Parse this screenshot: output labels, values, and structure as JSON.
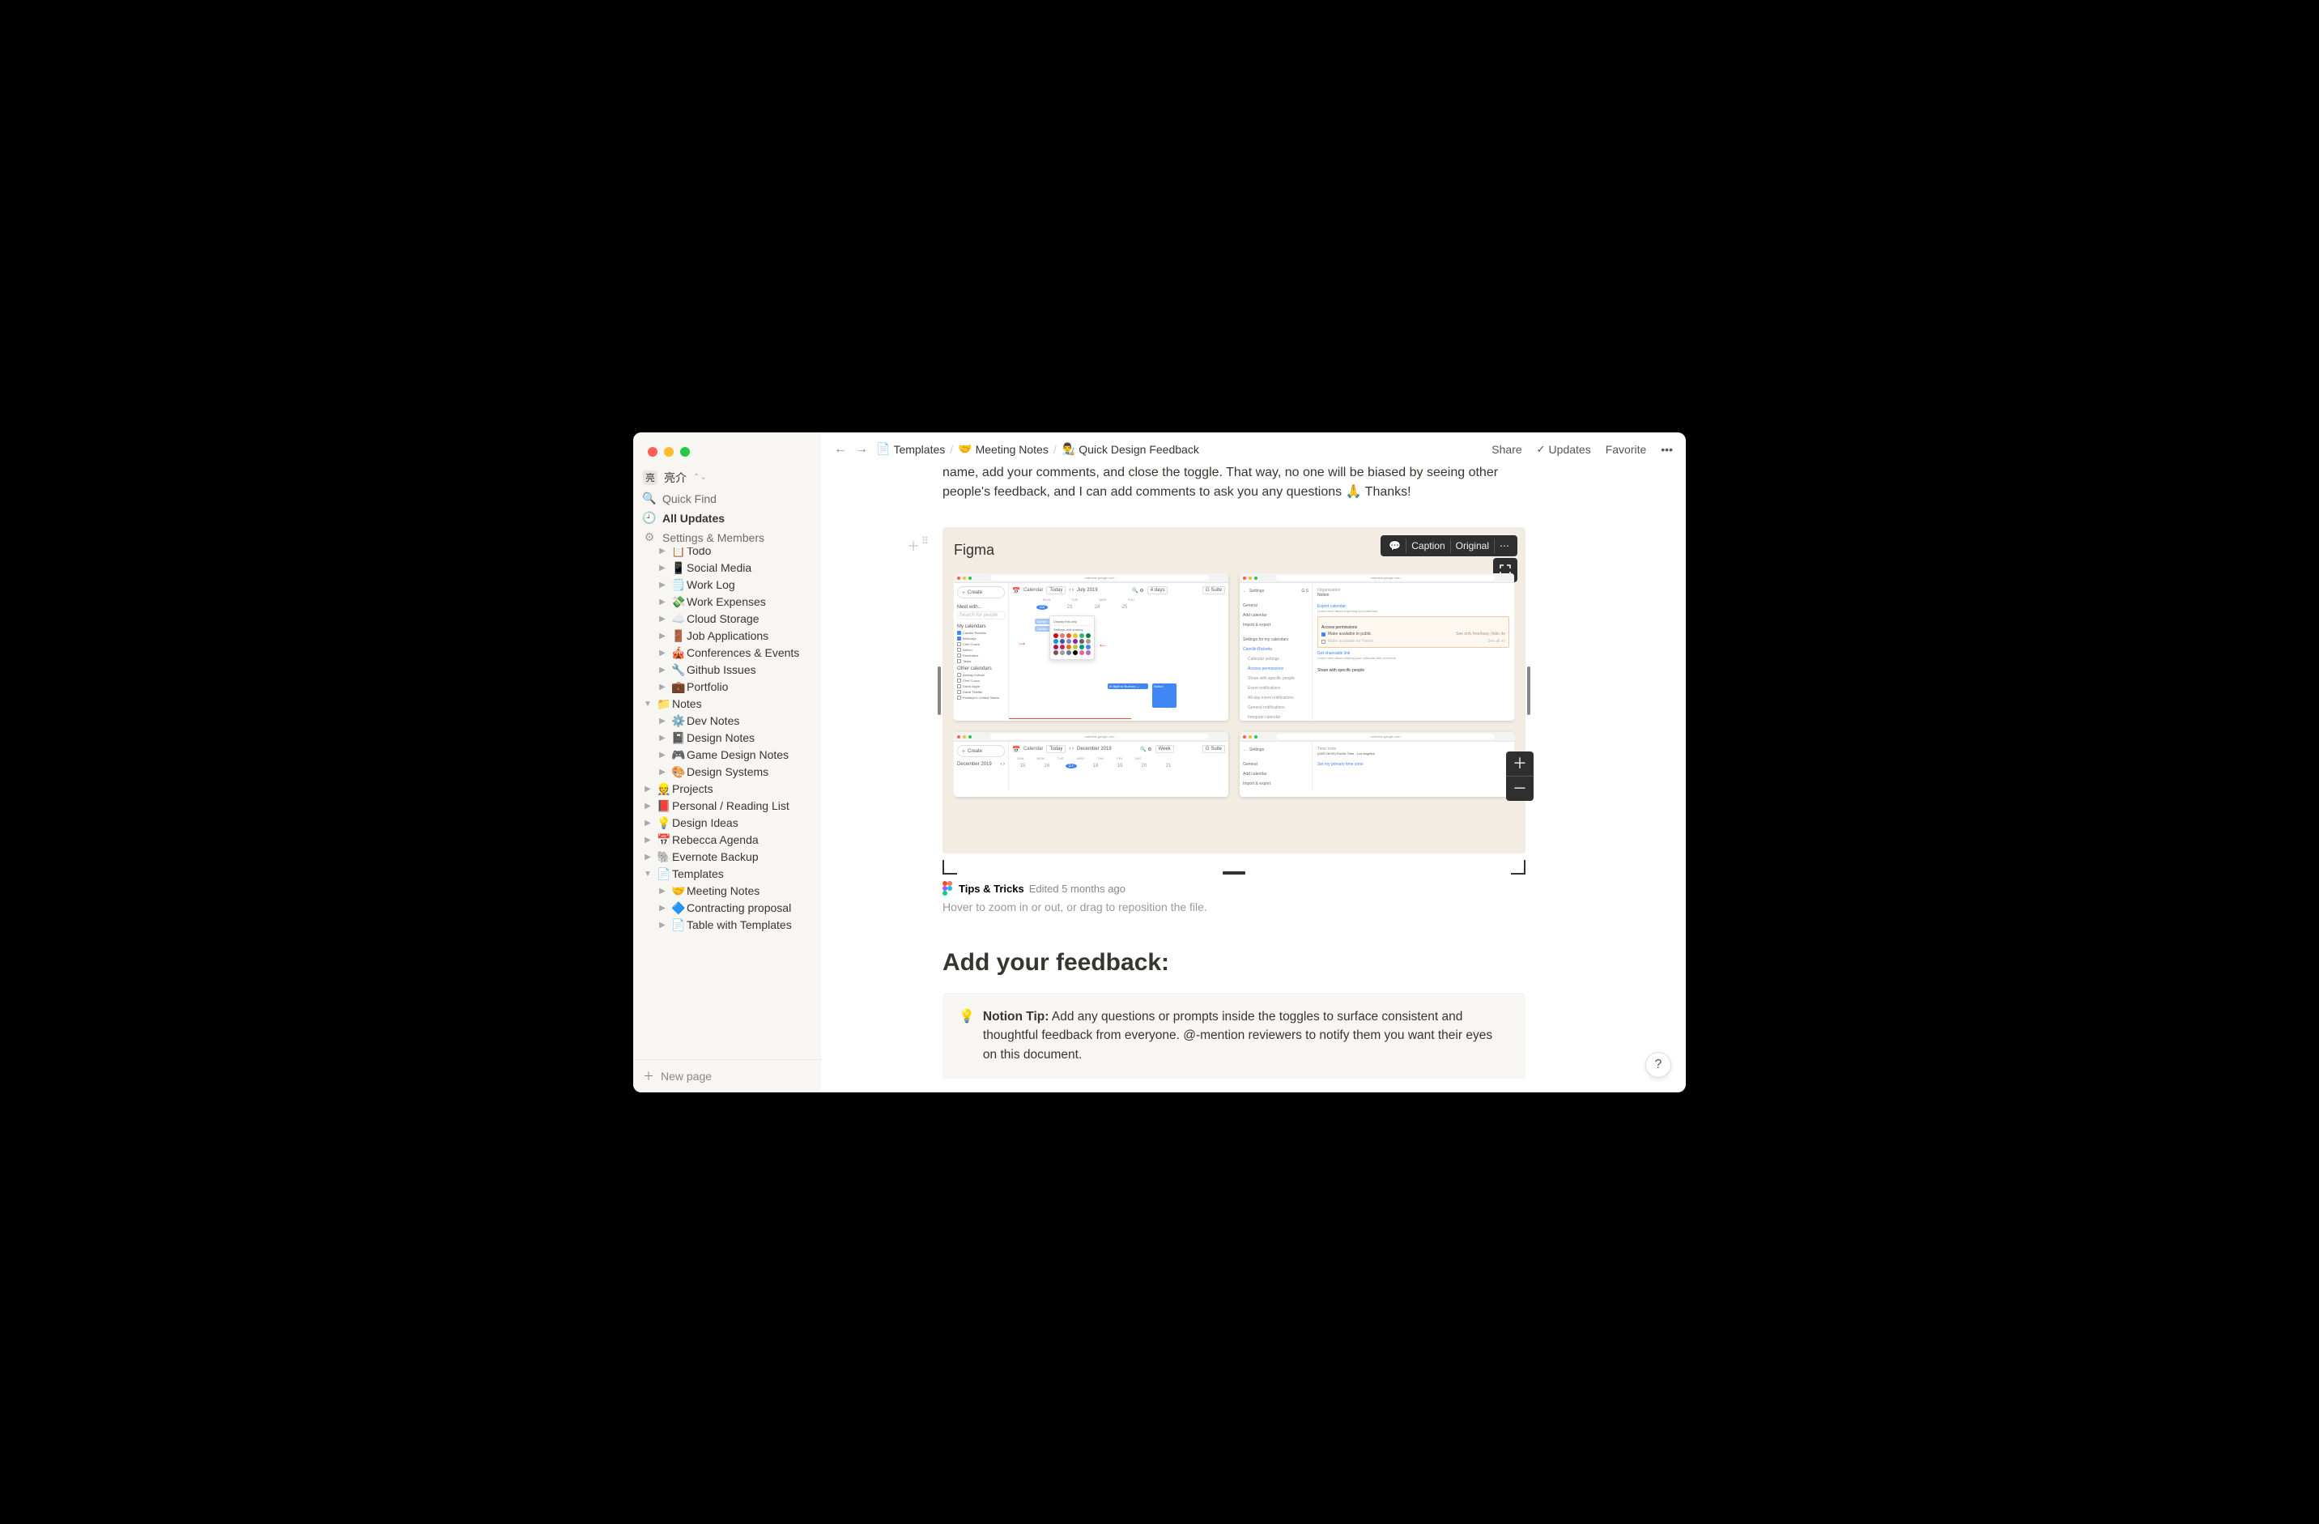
{
  "user": {
    "name": "亮介"
  },
  "quick_items": [
    {
      "icon": "search-icon",
      "label": "Quick Find"
    },
    {
      "icon": "clock-icon",
      "label": "All Updates",
      "active": true
    },
    {
      "icon": "gear-icon",
      "label": "Settings & Members"
    }
  ],
  "tree": [
    {
      "depth": 1,
      "arrow": "▶",
      "emoji": "📋",
      "label": "Todo",
      "cut": true
    },
    {
      "depth": 1,
      "arrow": "▶",
      "emoji": "📱",
      "label": "Social Media"
    },
    {
      "depth": 1,
      "arrow": "▶",
      "emoji": "🗒️",
      "label": "Work Log"
    },
    {
      "depth": 1,
      "arrow": "▶",
      "emoji": "💸",
      "label": "Work Expenses"
    },
    {
      "depth": 1,
      "arrow": "▶",
      "emoji": "☁️",
      "label": "Cloud Storage"
    },
    {
      "depth": 1,
      "arrow": "▶",
      "emoji": "🚪",
      "label": "Job Applications"
    },
    {
      "depth": 1,
      "arrow": "▶",
      "emoji": "🎪",
      "label": "Conferences & Events"
    },
    {
      "depth": 1,
      "arrow": "▶",
      "emoji": "🔧",
      "label": "Github Issues"
    },
    {
      "depth": 1,
      "arrow": "▶",
      "emoji": "💼",
      "label": "Portfolio"
    },
    {
      "depth": 0,
      "arrow": "▼",
      "emoji": "📁",
      "label": "Notes"
    },
    {
      "depth": 1,
      "arrow": "▶",
      "emoji": "⚙️",
      "label": "Dev Notes"
    },
    {
      "depth": 1,
      "arrow": "▶",
      "emoji": "📓",
      "label": "Design Notes"
    },
    {
      "depth": 1,
      "arrow": "▶",
      "emoji": "🎮",
      "label": "Game Design Notes"
    },
    {
      "depth": 1,
      "arrow": "▶",
      "emoji": "🎨",
      "label": "Design Systems"
    },
    {
      "depth": 0,
      "arrow": "▶",
      "emoji": "👷",
      "label": "Projects"
    },
    {
      "depth": 0,
      "arrow": "▶",
      "emoji": "📕",
      "label": "Personal / Reading List"
    },
    {
      "depth": 0,
      "arrow": "▶",
      "emoji": "💡",
      "label": "Design Ideas"
    },
    {
      "depth": 0,
      "arrow": "▶",
      "emoji": "📅",
      "label": "Rebecca Agenda"
    },
    {
      "depth": 0,
      "arrow": "▶",
      "emoji": "🐘",
      "label": "Evernote Backup"
    },
    {
      "depth": 0,
      "arrow": "▼",
      "emoji": "📄",
      "label": "Templates"
    },
    {
      "depth": 1,
      "arrow": "▶",
      "emoji": "🤝",
      "label": "Meeting Notes"
    },
    {
      "depth": 1,
      "arrow": "▶",
      "emoji": "🔷",
      "label": "Contracting proposal"
    },
    {
      "depth": 1,
      "arrow": "▶",
      "emoji": "📄",
      "label": "Table with Templates"
    }
  ],
  "new_page_label": "New page",
  "breadcrumb": [
    {
      "emoji": "📄",
      "label": "Templates"
    },
    {
      "emoji": "🤝",
      "label": "Meeting Notes"
    },
    {
      "emoji": "👨‍🎨",
      "label": "Quick Design Feedback"
    }
  ],
  "top_actions": {
    "share": "Share",
    "updates": "Updates",
    "favorite": "Favorite"
  },
  "intro_text": "name, add your comments, and close the toggle. That way, no one will be biased by seeing other people's feedback, and I can add comments to ask you any questions 🙏  Thanks!",
  "figma": {
    "title": "Figma",
    "toolbar": {
      "comment": "💬",
      "caption": "Caption",
      "original": "Original",
      "more": "⋯"
    },
    "caption": {
      "title": "Tips & Tricks",
      "edited": "Edited 5 months ago"
    },
    "hint": "Hover to zoom in or out, or drag to reposition the file.",
    "shot_url": "calendar.google.com",
    "shot1": {
      "app": "Calendar",
      "today": "Today",
      "month": "July 2019",
      "range": "4 days",
      "gsuite": "G Suite",
      "date_labels": [
        "MON",
        "TUE",
        "WED",
        "THU"
      ],
      "dates": [
        "22",
        "23",
        "24",
        "25"
      ],
      "meet_with": "Meet with...",
      "search": "Search for people",
      "my_cal": "My calendars",
      "cals": [
        "Camille Ricketts",
        "Birthdays",
        "Chef Cuoco",
        "Notion",
        "Reminders",
        "Tasks"
      ],
      "other_cal": "Other calendars",
      "others": [
        "Akshay Kothari",
        "Chef Cuoco",
        "David Apple",
        "David Tibbitts",
        "Holidays in United States"
      ],
      "menu": [
        "Display this only",
        "Settings and sharing"
      ],
      "event1": "Camille OoO",
      "event2": "In-flight to Buenos —",
      "event3": "Notion"
    },
    "shot2": {
      "app": "Settings",
      "nav": [
        "General",
        "Add calendar",
        "Import & export"
      ],
      "section": "Settings for my calendars",
      "nav2": [
        "Camille Ricketts",
        "Calendar settings",
        "Access permissions",
        "Share with specific people",
        "Event notifications",
        "All-day event notifications",
        "General notifications",
        "Integrate calendar"
      ],
      "org": "Organisation",
      "org_val": "Notion",
      "export": "Export calendar",
      "export_hint": "Learn more about exporting your calendar",
      "access": "Access permissions",
      "make_public": "Make available to public",
      "see_only": "See only free/busy (hide de",
      "see_all": "See all ev",
      "make_notion": "Make available for Notion",
      "shareable": "Get shareable link",
      "learn": "Learn more about sharing your calendar with someone",
      "share_section": "Share with specific people"
    },
    "shot3": {
      "app": "Calendar",
      "today": "Today",
      "month": "December 2019",
      "view": "Week",
      "gsuite": "G Suite",
      "date_labels": [
        "SUN",
        "MON",
        "TUE",
        "WED",
        "THU",
        "FRI",
        "SAT"
      ],
      "dates": [
        "15",
        "16",
        "17",
        "18",
        "19",
        "20",
        "21"
      ],
      "create": "Create",
      "mini_month": "December 2019"
    },
    "shot4": {
      "app": "Settings",
      "nav": [
        "General",
        "Add calendar",
        "Import & export"
      ],
      "tz": "Time zone",
      "tz_val": "(GMT-08:00) Pacific Time - Los Angeles",
      "set_tz": "Set my primary time zone"
    }
  },
  "heading": "Add your feedback:",
  "tip": {
    "label": "Notion Tip:",
    "body": " Add any questions or prompts inside the toggles to surface consistent and thoughtful feedback from everyone. @-mention reviewers to notify them you want their eyes on this document."
  },
  "palette_colors": [
    [
      "#d50000",
      "#e67c73",
      "#f4511e",
      "#f6bf26",
      "#33b679",
      "#0b8043"
    ],
    [
      "#039be5",
      "#3f51b5",
      "#7986cb",
      "#8e24aa",
      "#616161",
      "#a79b8e"
    ],
    [
      "#ad1457",
      "#d81b60",
      "#ef6c00",
      "#c0ca33",
      "#009688",
      "#4285f4"
    ],
    [
      "#795548",
      "#9e9e9e",
      "#607d8b",
      "#000000",
      "#f06292",
      "#ba68c8"
    ]
  ]
}
